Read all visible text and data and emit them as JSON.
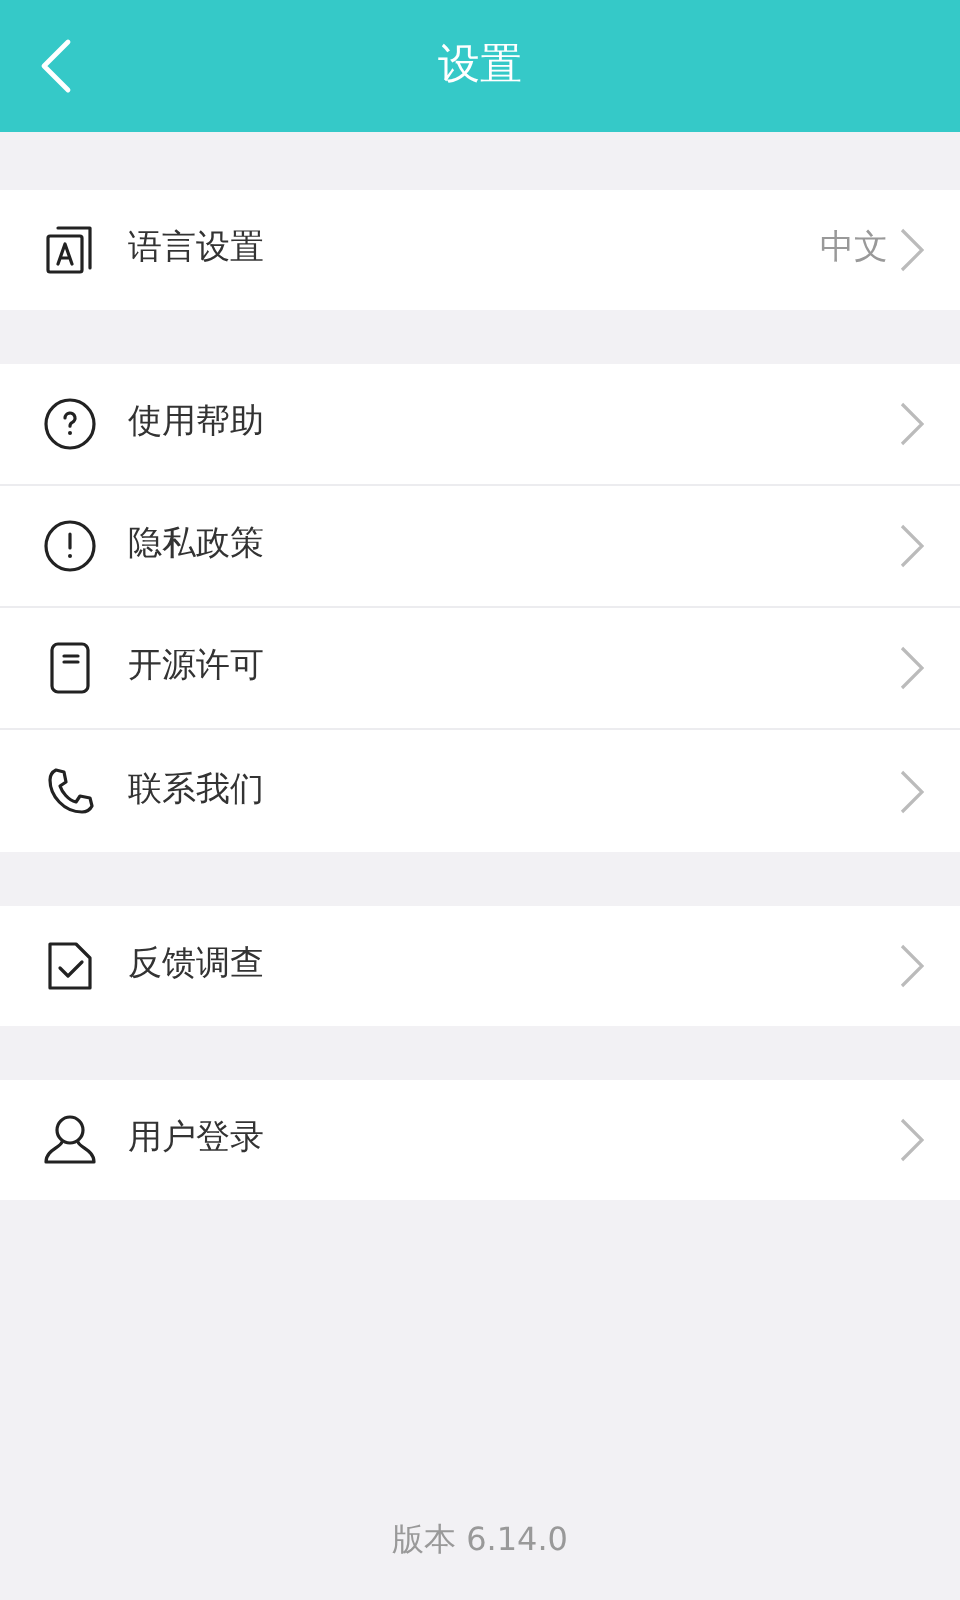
{
  "header": {
    "title": "设置"
  },
  "groups": [
    {
      "items": [
        {
          "kind": "language",
          "label": "语言设置",
          "value": "中文"
        }
      ]
    },
    {
      "items": [
        {
          "kind": "help",
          "label": "使用帮助"
        },
        {
          "kind": "privacy",
          "label": "隐私政策"
        },
        {
          "kind": "license",
          "label": "开源许可"
        },
        {
          "kind": "phone",
          "label": "联系我们"
        }
      ]
    },
    {
      "items": [
        {
          "kind": "survey",
          "label": "反馈调查"
        }
      ]
    },
    {
      "items": [
        {
          "kind": "user",
          "label": "用户登录"
        }
      ]
    }
  ],
  "version": "版本 6.14.0"
}
